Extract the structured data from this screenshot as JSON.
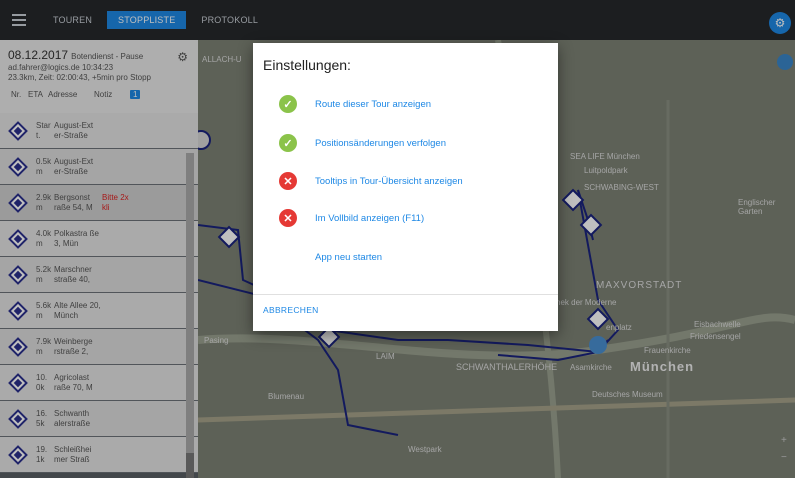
{
  "topbar": {
    "tabs": [
      {
        "label": "TOUREN",
        "active": false
      },
      {
        "label": "STOPPLISTE",
        "active": true
      },
      {
        "label": "PROTOKOLL",
        "active": false
      }
    ],
    "menu_icon": "hamburger-icon",
    "settings_icon": "gear-icon"
  },
  "panel": {
    "date": "08.12.2017",
    "title_rest": "Botendienst - Pause",
    "user_line": "ad.fahrer@logics.de 10:34:23",
    "stats_line": "23.3km, Zeit: 02:00:43, +5min pro Stopp",
    "columns": {
      "nr": "Nr.",
      "eta": "ETA",
      "address": "Adresse",
      "note": "Notiz",
      "badge": "1"
    },
    "rows": [
      {
        "eta": "Star t.",
        "address": "August-Ext er-Straße",
        "note": ""
      },
      {
        "eta": "0.5k m",
        "address": "August-Ext er-Straße",
        "note": ""
      },
      {
        "eta": "2.9k m",
        "address": "Bergsonst raße 54, M",
        "note": "Bitte 2x kli"
      },
      {
        "eta": "4.0k m",
        "address": "Polkastra ße 3, Mün",
        "note": ""
      },
      {
        "eta": "5.2k m",
        "address": "Marschner straße 40,",
        "note": ""
      },
      {
        "eta": "5.6k m",
        "address": "Alte Allee 20, Münch",
        "note": ""
      },
      {
        "eta": "7.9k m",
        "address": "Weinberge rstraße 2,",
        "note": ""
      },
      {
        "eta": "10. 0k",
        "address": "Agricolast raße 70, M",
        "note": ""
      },
      {
        "eta": "16. 5k",
        "address": "Schwanth alerstraße",
        "note": ""
      },
      {
        "eta": "19. 1k",
        "address": "Schleißhei mer Straß",
        "note": ""
      }
    ]
  },
  "map": {
    "labels": [
      "ALLACH-U",
      "SEA LIFE München",
      "Luitpoldpark",
      "SCHWABING-WEST",
      "Englischer Garten",
      "MAXVORSTADT",
      "Pasing",
      "LAIM",
      "SCHWANTHALERHÖHE",
      "Asamkirche",
      "München",
      "Deutsches Museum",
      "Blumenau",
      "Westpark",
      "Frauenkirche",
      "Eisbachwelle",
      "Friedensengel",
      "enplatz",
      "hek der Moderne"
    ],
    "route_color": "#1a237e"
  },
  "dialog": {
    "title": "Einstellungen:",
    "options": [
      {
        "label": "Route dieser Tour anzeigen",
        "state": "on",
        "icon": "check-circle-icon"
      },
      {
        "label": "Positionsänderungen verfolgen",
        "state": "on",
        "icon": "check-circle-icon"
      },
      {
        "label": "Tooltips in Tour-Übersicht anzeigen",
        "state": "off",
        "icon": "x-circle-icon"
      },
      {
        "label": "Im Vollbild anzeigen (F11)",
        "state": "off",
        "icon": "x-circle-icon"
      }
    ],
    "restart_label": "App neu starten",
    "cancel_label": "ABBRECHEN"
  }
}
